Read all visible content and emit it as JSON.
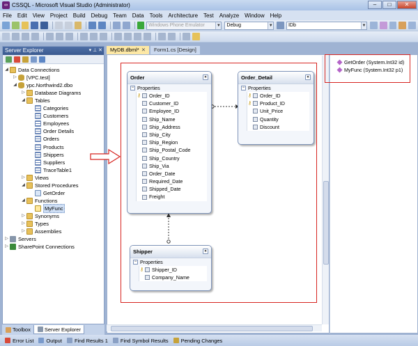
{
  "window": {
    "title": "CSSQL - Microsoft Visual Studio (Administrator)"
  },
  "menu": [
    "File",
    "Edit",
    "View",
    "Project",
    "Build",
    "Debug",
    "Team",
    "Data",
    "Tools",
    "Architecture",
    "Test",
    "Analyze",
    "Window",
    "Help"
  ],
  "toolbar": {
    "target_combo": "Windows Phone Emulator",
    "config_combo": "Debug",
    "find_combo": "IDb"
  },
  "server_explorer": {
    "title": "Server Explorer",
    "tree": [
      {
        "label": "Data Connections",
        "indent": 0,
        "icon": "folder",
        "expanded": true
      },
      {
        "label": "[VPC.test]",
        "indent": 1,
        "icon": "db",
        "expanded": false
      },
      {
        "label": "ypc.Northwind2.dbo",
        "indent": 1,
        "icon": "db",
        "expanded": true
      },
      {
        "label": "Database Diagrams",
        "indent": 2,
        "icon": "folder",
        "expanded": false
      },
      {
        "label": "Tables",
        "indent": 2,
        "icon": "folder",
        "expanded": true
      },
      {
        "label": "Categories",
        "indent": 3,
        "icon": "table"
      },
      {
        "label": "Customers",
        "indent": 3,
        "icon": "table"
      },
      {
        "label": "Employees",
        "indent": 3,
        "icon": "table"
      },
      {
        "label": "Order Details",
        "indent": 3,
        "icon": "table"
      },
      {
        "label": "Orders",
        "indent": 3,
        "icon": "table"
      },
      {
        "label": "Products",
        "indent": 3,
        "icon": "table"
      },
      {
        "label": "Shippers",
        "indent": 3,
        "icon": "table"
      },
      {
        "label": "Suppliers",
        "indent": 3,
        "icon": "table"
      },
      {
        "label": "TraceTable1",
        "indent": 3,
        "icon": "table"
      },
      {
        "label": "Views",
        "indent": 2,
        "icon": "folder",
        "expanded": false
      },
      {
        "label": "Stored Procedures",
        "indent": 2,
        "icon": "folder",
        "expanded": true
      },
      {
        "label": "GetOrder",
        "indent": 3,
        "icon": "proc"
      },
      {
        "label": "Functions",
        "indent": 2,
        "icon": "folder",
        "expanded": true
      },
      {
        "label": "MyFunc",
        "indent": 3,
        "icon": "func",
        "selected": true
      },
      {
        "label": "Synonyms",
        "indent": 2,
        "icon": "folder",
        "expanded": false
      },
      {
        "label": "Types",
        "indent": 2,
        "icon": "folder",
        "expanded": false
      },
      {
        "label": "Assemblies",
        "indent": 2,
        "icon": "folder",
        "expanded": false
      },
      {
        "label": "Servers",
        "indent": 0,
        "icon": "server",
        "expanded": false
      },
      {
        "label": "SharePoint Connections",
        "indent": 0,
        "icon": "sp",
        "expanded": false
      }
    ],
    "bottom_tabs": [
      "Toolbox",
      "Server Explorer"
    ]
  },
  "doc_tabs": [
    {
      "label": "MyDB.dbml*",
      "active": true
    },
    {
      "label": "Form1.cs [Design]",
      "active": false
    }
  ],
  "entities": {
    "order": {
      "name": "Order",
      "section": "Properties",
      "props": [
        {
          "name": "Order_ID",
          "key": true
        },
        {
          "name": "Customer_ID"
        },
        {
          "name": "Employee_ID"
        },
        {
          "name": "Ship_Name"
        },
        {
          "name": "Ship_Address"
        },
        {
          "name": "Ship_City"
        },
        {
          "name": "Ship_Region"
        },
        {
          "name": "Ship_Postal_Code"
        },
        {
          "name": "Ship_Country"
        },
        {
          "name": "Ship_Via"
        },
        {
          "name": "Order_Date"
        },
        {
          "name": "Required_Date"
        },
        {
          "name": "Shipped_Date"
        },
        {
          "name": "Freight"
        }
      ]
    },
    "order_detail": {
      "name": "Order_Detail",
      "section": "Properties",
      "props": [
        {
          "name": "Order_ID",
          "key": true
        },
        {
          "name": "Product_ID",
          "key": true
        },
        {
          "name": "Unit_Price"
        },
        {
          "name": "Quantity"
        },
        {
          "name": "Discount"
        }
      ]
    },
    "shipper": {
      "name": "Shipper",
      "section": "Properties",
      "props": [
        {
          "name": "Shipper_ID",
          "key": true
        },
        {
          "name": "Company_Name"
        }
      ]
    }
  },
  "methods": [
    "GetOrder (System.Int32 id)",
    "MyFunc (System.Int32 p1)"
  ],
  "statusbar": [
    "Error List",
    "Output",
    "Find Results 1",
    "Find Symbol Results",
    "Pending Changes"
  ],
  "colors": {
    "annotation_red": "#d7231f",
    "title_bar": "#a9c2e6",
    "active_doc_tab": "#fde8a5"
  }
}
